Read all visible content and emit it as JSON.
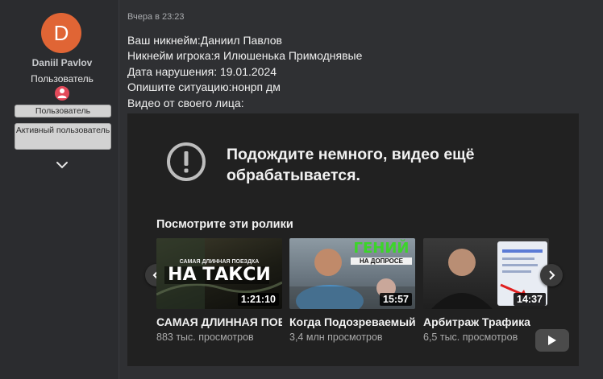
{
  "author": {
    "avatar_letter": "D",
    "name": "Daniil Pavlov",
    "role": "Пользователь",
    "banners": [
      "Пользователь",
      "Активный пользователь"
    ]
  },
  "post": {
    "timestamp": "Вчера в 23:23",
    "lines": [
      "Ваш никнейм:Даниил Павлов",
      "Никнейм игрока:я Илюшенька Примоднявые",
      "Дата нарушения: 19.01.2024",
      "Опишите ситуацию:нонрп дм",
      "Видео от своего лица:"
    ]
  },
  "video": {
    "processing_message": "Подождите немного, видео ещё обрабатывается.",
    "suggestions_title": "Посмотрите эти ролики",
    "cards": [
      {
        "title": "САМАЯ ДЛИННАЯ ПОЕЗДКА НА ТАКСИ",
        "views": "883 тыс. просмотров",
        "duration": "1:21:10",
        "thumb_text_top": "САМАЯ ДЛИННАЯ ПОЕЗДКА",
        "thumb_text_main": "НА ТАКСИ"
      },
      {
        "title": "Когда Подозреваемый Гений на допросе",
        "views": "3,4 млн просмотров",
        "duration": "15:57",
        "thumb_text_top": "ГЕНИЙ",
        "thumb_text_main": "НА ДОПРОСЕ"
      },
      {
        "title": "Арбитраж Трафика",
        "views": "6,5 тыс. просмотров",
        "duration": "14:37"
      }
    ]
  },
  "colors": {
    "avatar_bg": "#e06535",
    "role_icon": "#e34a5a",
    "page_bg": "#2f3033",
    "video_bg": "#212121"
  }
}
